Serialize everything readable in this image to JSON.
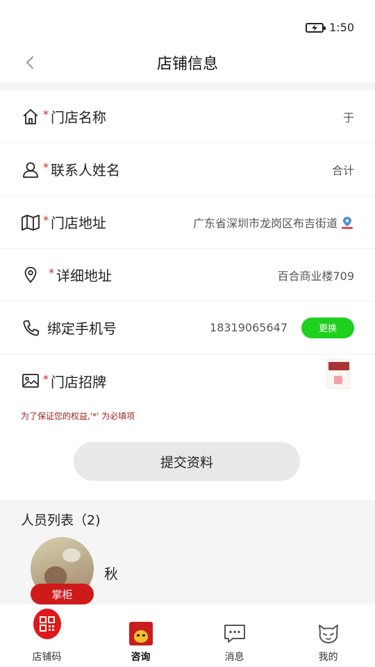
{
  "status": {
    "time": "1:50"
  },
  "nav": {
    "title": "店铺信息"
  },
  "form": {
    "store_name": {
      "label": "门店名称",
      "value": "于"
    },
    "contact_name": {
      "label": "联系人姓名",
      "value": "合计"
    },
    "store_address": {
      "label": "门店地址",
      "value": "广东省深圳市龙岗区布吉街道"
    },
    "detail_address": {
      "label": "详细地址",
      "value": "百合商业楼709"
    },
    "phone": {
      "label": "绑定手机号",
      "value": "18319065647",
      "change_label": "更换"
    },
    "signboard": {
      "label": "门店招牌"
    },
    "required_mark": "*",
    "notice": "为了保证您的权益,'*' 为必填项",
    "submit_label": "提交资料"
  },
  "staff": {
    "title": "人员列表（2)",
    "members": [
      {
        "name": "秋",
        "role": "掌柜"
      }
    ]
  },
  "tabs": [
    {
      "label": "店铺码",
      "icon": "qr-code-icon"
    },
    {
      "label": "咨询",
      "icon": "consult-icon"
    },
    {
      "label": "消息",
      "icon": "message-icon"
    },
    {
      "label": "我的",
      "icon": "profile-icon"
    }
  ],
  "colors": {
    "accent_red": "#cf1a1a",
    "change_green": "#1fd01f",
    "required_red": "#d42020"
  }
}
